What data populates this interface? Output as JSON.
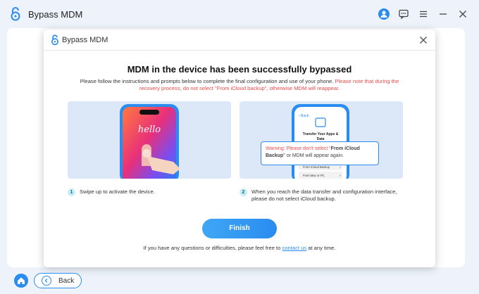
{
  "app": {
    "title": "Bypass MDM"
  },
  "dialog": {
    "title": "Bypass MDM",
    "headline": "MDM in the device has been successfully bypassed",
    "description_normal": "Please follow the instructions and prompts below to complete the final configuration and use of your phone. ",
    "description_warning": "Please note that during the recovery process, do not select \"From iCloud backup\", otherwise MDM will reappear.",
    "steps": [
      {
        "number": "1",
        "text": "Swipe up to activate the device."
      },
      {
        "number": "2",
        "text": "When you reach the data transfer and configuration interface, please do not select iCloud backup."
      }
    ],
    "phone_left_text": "hello",
    "phone_right": {
      "screen_title": "Transfer Your Apps & Data",
      "option_1": "From iCloud Backup",
      "option_2": "From Mac or PC",
      "warning_prefix": "Warning: Please don't select \"",
      "warning_bold": "From iCloud Backup",
      "warning_suffix": "\" or MDM will appear again."
    },
    "finish_label": "Finish",
    "footer_prefix": "If you have any questions or difficulties, please feel free to ",
    "footer_link": "contact us",
    "footer_suffix": " at any time."
  },
  "bottom": {
    "back_label": "Back"
  },
  "colors": {
    "accent": "#2a8cf0",
    "warning": "#ee4a4a",
    "card_bg": "#dce8f8",
    "window_bg": "#eef3fb"
  },
  "icons": [
    "lock-logo-icon",
    "user-icon",
    "feedback-icon",
    "menu-icon",
    "minimize-icon",
    "close-icon",
    "home-icon",
    "back-arrow-icon",
    "hand-icon"
  ]
}
